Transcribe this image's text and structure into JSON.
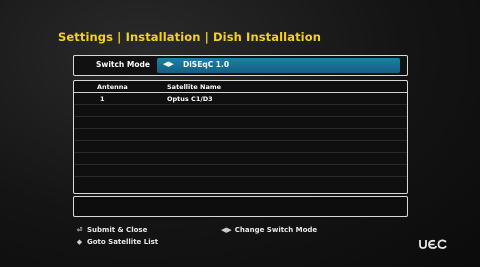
{
  "header": {
    "title": "Settings | Installation | Dish Installation"
  },
  "switch_mode": {
    "label": "Switch Mode",
    "value": "DiSEqC 1.0",
    "arrows_icon": "left-right-arrows-icon"
  },
  "satellite_list": {
    "columns": [
      "Antenna",
      "Satellite Name"
    ],
    "rows": [
      {
        "antenna": "1",
        "satellite": "Optus C1/D3"
      }
    ]
  },
  "help": {
    "submit": "Submit & Close",
    "goto": "Goto Satellite List",
    "change": "Change Switch Mode"
  },
  "colors": {
    "title": "#f5d21a",
    "highlight": "#1d7fa8",
    "border": "#d8d8d8"
  }
}
